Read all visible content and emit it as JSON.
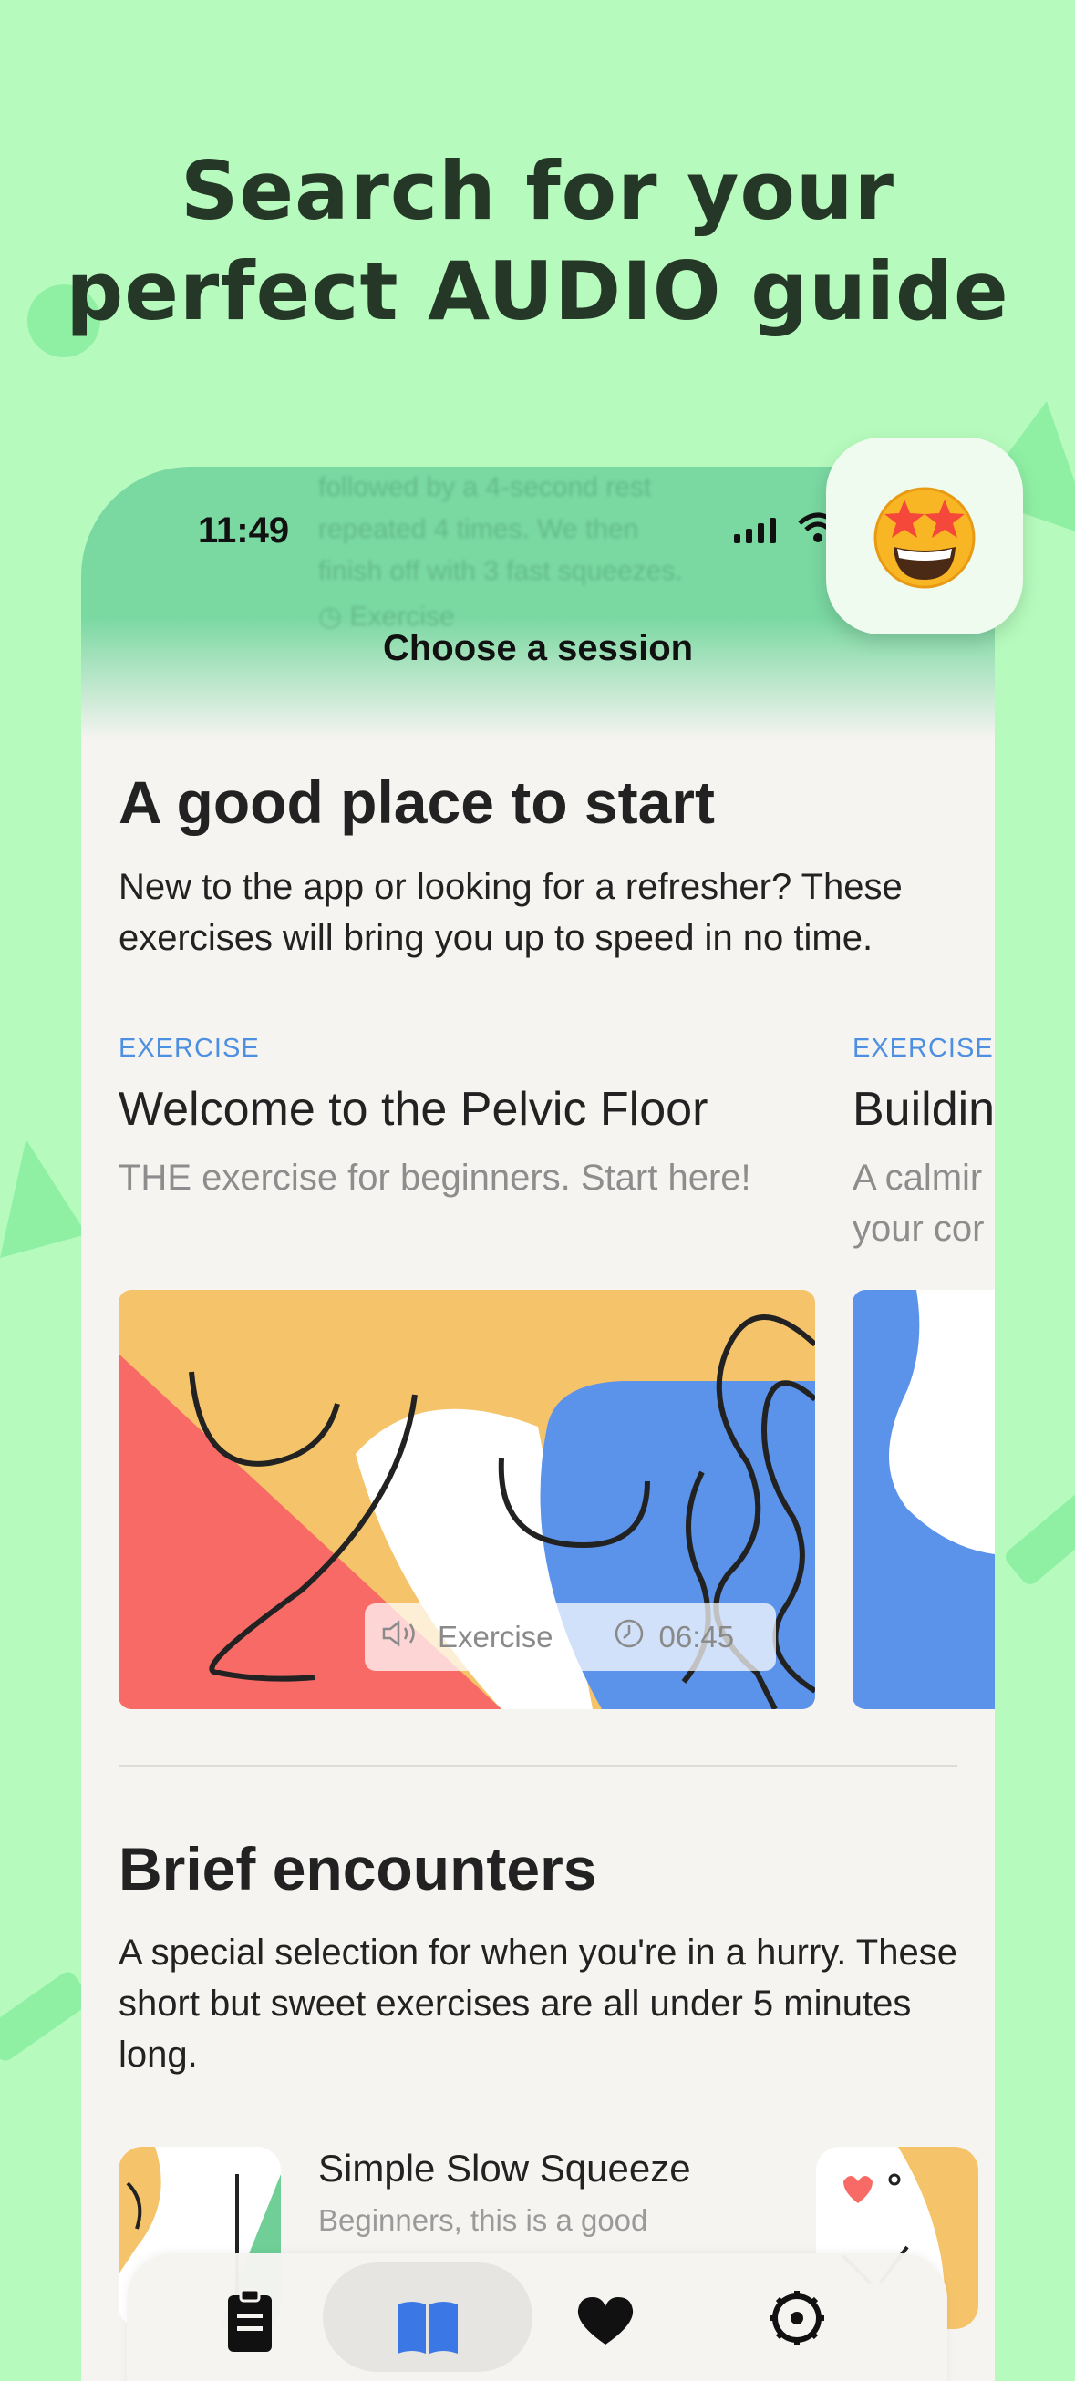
{
  "headline": {
    "line1": "Search for your",
    "line2": "perfect AUDIO guide"
  },
  "status_bar": {
    "time": "11:49"
  },
  "nav": {
    "title": "Choose a session"
  },
  "ghost_text": {
    "line1": "followed by a 4-second rest",
    "line2": "repeated 4 times. We then",
    "line3": "finish off with 3 fast squeezes.",
    "tag": "Exercise"
  },
  "section1": {
    "title": "A good place to start",
    "description": "New to the app or looking for a refresher? These exercises will bring you up to speed in no time.",
    "cards": [
      {
        "tag": "EXERCISE",
        "title": "Welcome to the Pelvic Floor",
        "subtitle": "THE exercise for beginners. Start here!",
        "type_label": "Exercise",
        "duration": "06:45"
      },
      {
        "tag": "EXERCISE",
        "title": "Buildin",
        "subtitle_line1": "A calmir",
        "subtitle_line2": "your cor"
      }
    ]
  },
  "section2": {
    "title": "Brief encounters",
    "description": "A special selection for when you're in a hurry. These short but sweet exercises are all under 5 minutes long.",
    "items": [
      {
        "title": "Simple Slow Squeeze",
        "subtitle": "Beginners, this is a good"
      }
    ]
  },
  "tabbar": {
    "items": [
      "plan",
      "library",
      "favorites",
      "settings"
    ],
    "active": "library"
  },
  "badge": {
    "icon": "star-struck-emoji-icon"
  },
  "colors": {
    "background": "#b6fbbd",
    "header_green": "#7ad8a1",
    "accent_blue": "#4d8fe0",
    "art_red": "#f86a66",
    "art_yellow": "#f5c46a",
    "art_blue": "#5b93ea"
  }
}
